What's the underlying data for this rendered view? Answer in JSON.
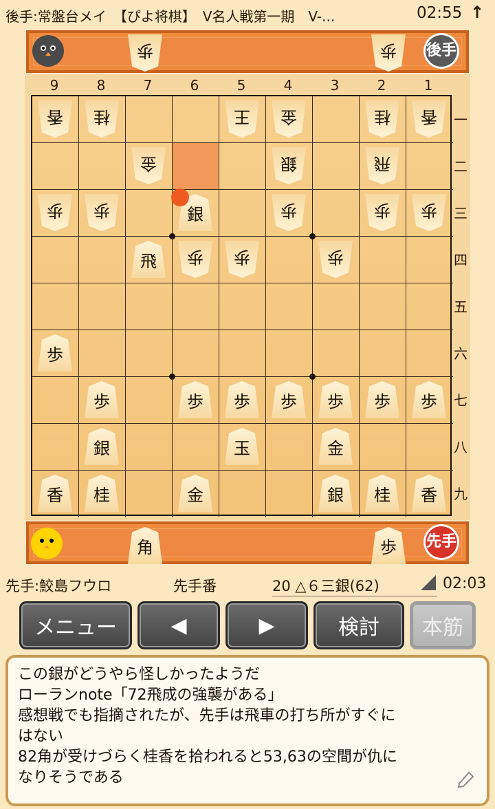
{
  "top": {
    "title": "後手:常盤台メイ　【ぴよ将棋】　V名人戦第一期　V-...",
    "clock": "02:55",
    "arrow": "↑"
  },
  "gote_stand": {
    "hand": [
      "歩",
      "歩"
    ],
    "badge": "後手"
  },
  "sente_stand": {
    "hand": [
      "角",
      "歩"
    ],
    "badge": "先手"
  },
  "col_labels": [
    "9",
    "8",
    "7",
    "6",
    "5",
    "4",
    "3",
    "2",
    "1"
  ],
  "row_labels": [
    "一",
    "二",
    "三",
    "四",
    "五",
    "六",
    "七",
    "八",
    "九"
  ],
  "board_pieces": [
    {
      "c": 9,
      "r": 1,
      "t": "香",
      "o": "g"
    },
    {
      "c": 8,
      "r": 1,
      "t": "桂",
      "o": "g"
    },
    {
      "c": 5,
      "r": 1,
      "t": "王",
      "o": "g"
    },
    {
      "c": 4,
      "r": 1,
      "t": "金",
      "o": "g"
    },
    {
      "c": 2,
      "r": 1,
      "t": "桂",
      "o": "g"
    },
    {
      "c": 1,
      "r": 1,
      "t": "香",
      "o": "g"
    },
    {
      "c": 7,
      "r": 2,
      "t": "金",
      "o": "g"
    },
    {
      "c": 4,
      "r": 2,
      "t": "銀",
      "o": "g"
    },
    {
      "c": 2,
      "r": 2,
      "t": "飛",
      "o": "g"
    },
    {
      "c": 9,
      "r": 3,
      "t": "歩",
      "o": "g"
    },
    {
      "c": 8,
      "r": 3,
      "t": "歩",
      "o": "g"
    },
    {
      "c": 6,
      "r": 3,
      "t": "銀",
      "o": "s"
    },
    {
      "c": 4,
      "r": 3,
      "t": "歩",
      "o": "g"
    },
    {
      "c": 2,
      "r": 3,
      "t": "歩",
      "o": "g"
    },
    {
      "c": 1,
      "r": 3,
      "t": "歩",
      "o": "g"
    },
    {
      "c": 7,
      "r": 4,
      "t": "飛",
      "o": "s"
    },
    {
      "c": 6,
      "r": 4,
      "t": "歩",
      "o": "g"
    },
    {
      "c": 5,
      "r": 4,
      "t": "歩",
      "o": "g"
    },
    {
      "c": 3,
      "r": 4,
      "t": "歩",
      "o": "g"
    },
    {
      "c": 9,
      "r": 6,
      "t": "歩",
      "o": "s"
    },
    {
      "c": 8,
      "r": 7,
      "t": "歩",
      "o": "s"
    },
    {
      "c": 6,
      "r": 7,
      "t": "歩",
      "o": "s"
    },
    {
      "c": 5,
      "r": 7,
      "t": "歩",
      "o": "s"
    },
    {
      "c": 4,
      "r": 7,
      "t": "歩",
      "o": "s"
    },
    {
      "c": 3,
      "r": 7,
      "t": "歩",
      "o": "s"
    },
    {
      "c": 2,
      "r": 7,
      "t": "歩",
      "o": "s"
    },
    {
      "c": 1,
      "r": 7,
      "t": "歩",
      "o": "s"
    },
    {
      "c": 8,
      "r": 8,
      "t": "銀",
      "o": "s"
    },
    {
      "c": 5,
      "r": 8,
      "t": "玉",
      "o": "s"
    },
    {
      "c": 3,
      "r": 8,
      "t": "金",
      "o": "s"
    },
    {
      "c": 9,
      "r": 9,
      "t": "香",
      "o": "s"
    },
    {
      "c": 8,
      "r": 9,
      "t": "桂",
      "o": "s"
    },
    {
      "c": 6,
      "r": 9,
      "t": "金",
      "o": "s"
    },
    {
      "c": 3,
      "r": 9,
      "t": "銀",
      "o": "s"
    },
    {
      "c": 2,
      "r": 9,
      "t": "桂",
      "o": "s"
    },
    {
      "c": 1,
      "r": 9,
      "t": "香",
      "o": "s"
    }
  ],
  "last_move_from": {
    "c": 6,
    "r": 2
  },
  "last_move_to": {
    "c": 6,
    "r": 3
  },
  "info": {
    "sente_name": "先手:鮫島フウロ",
    "turn": "先手番",
    "move": "20 △６三銀(62)",
    "clock": "02:03"
  },
  "buttons": {
    "menu": "メニュー",
    "prev": "◀",
    "next": "▶",
    "review": "検討",
    "mainline": "本筋"
  },
  "comment_lines": [
    "この銀がどうやら怪しかったようだ",
    "ローランnote「72飛成の強襲がある」",
    "感想戦でも指摘されたが、先手は飛車の打ち所がすぐに",
    "はない",
    "82角が受けづらく桂香を拾われると53,63の空間が仇に",
    "なりそうである"
  ],
  "colors": {
    "accent": "#f08a3c",
    "board": "#f6cf8c",
    "highlight": "#f39a5a",
    "marker": "#f05a20"
  }
}
